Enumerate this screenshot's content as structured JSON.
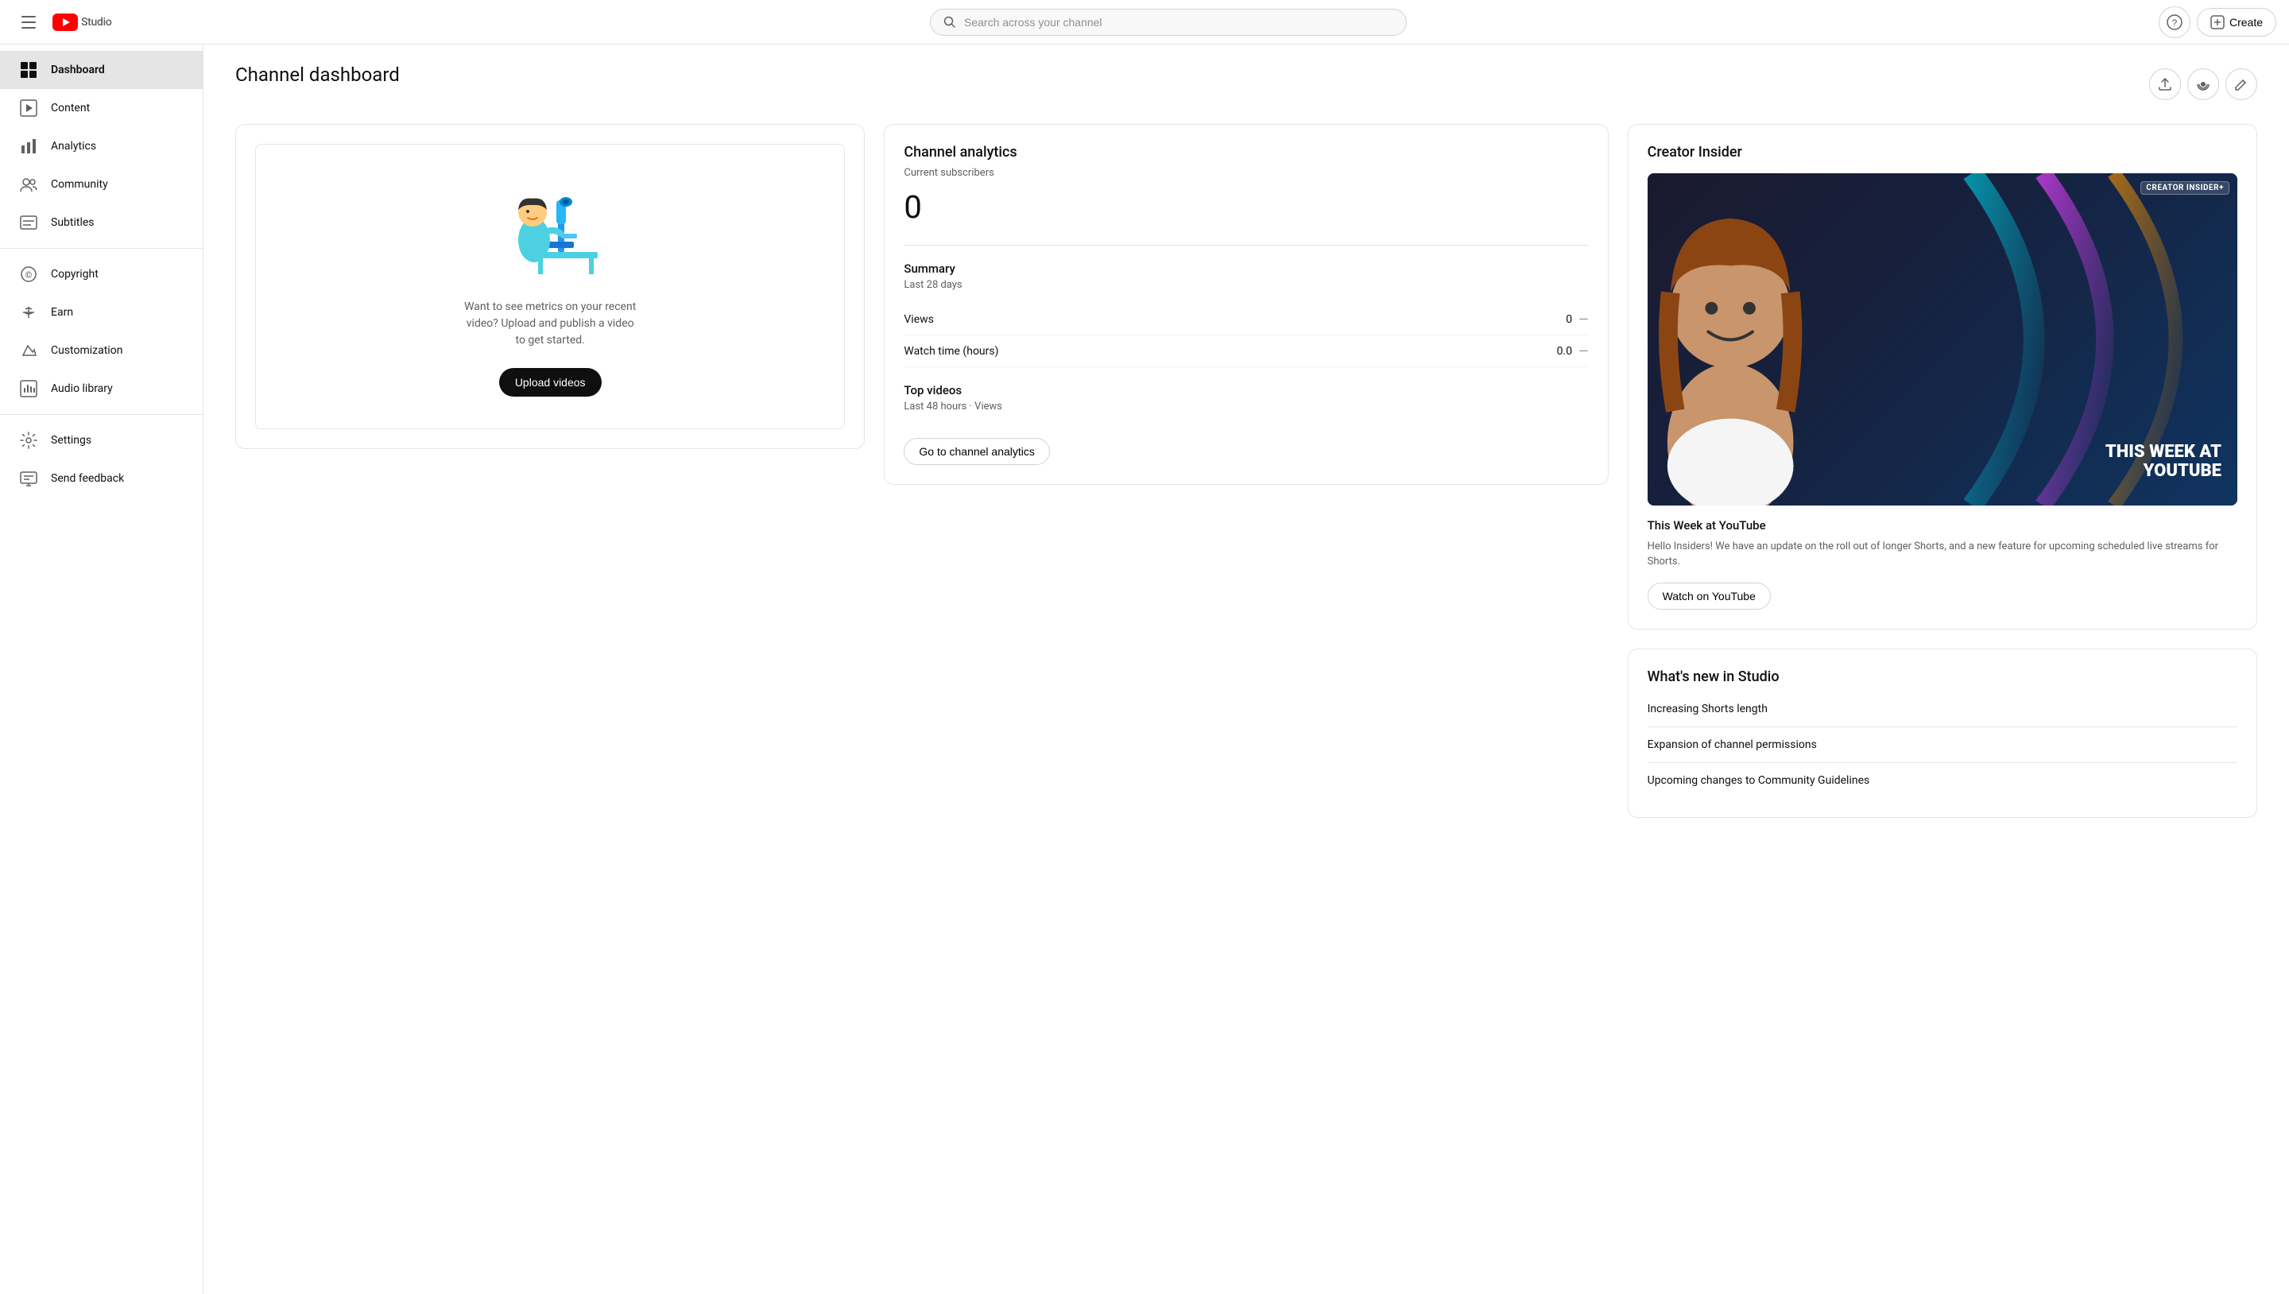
{
  "header": {
    "search_placeholder": "Search across your channel",
    "create_label": "Create",
    "help_title": "Help"
  },
  "sidebar": {
    "items": [
      {
        "id": "dashboard",
        "label": "Dashboard",
        "active": true
      },
      {
        "id": "content",
        "label": "Content",
        "active": false
      },
      {
        "id": "analytics",
        "label": "Analytics",
        "active": false
      },
      {
        "id": "community",
        "label": "Community",
        "active": false
      },
      {
        "id": "subtitles",
        "label": "Subtitles",
        "active": false
      },
      {
        "id": "copyright",
        "label": "Copyright",
        "active": false
      },
      {
        "id": "earn",
        "label": "Earn",
        "active": false
      },
      {
        "id": "customization",
        "label": "Customization",
        "active": false
      },
      {
        "id": "audio-library",
        "label": "Audio library",
        "active": false
      },
      {
        "id": "settings",
        "label": "Settings",
        "active": false
      },
      {
        "id": "send-feedback",
        "label": "Send feedback",
        "active": false
      }
    ]
  },
  "page": {
    "title": "Channel dashboard"
  },
  "upload_card": {
    "description": "Want to see metrics on your recent video? Upload and publish a video to get started.",
    "button_label": "Upload videos"
  },
  "analytics_card": {
    "title": "Channel analytics",
    "subscribers_label": "Current subscribers",
    "subscribers_count": "0",
    "summary_title": "Summary",
    "summary_period": "Last 28 days",
    "views_label": "Views",
    "views_value": "0",
    "watch_time_label": "Watch time (hours)",
    "watch_time_value": "0.0",
    "top_videos_title": "Top videos",
    "top_videos_period": "Last 48 hours · Views",
    "go_analytics_label": "Go to channel analytics"
  },
  "creator_insider": {
    "card_title": "Creator Insider",
    "badge_text": "CREATOR INSIDER+",
    "thumbnail_text": "THIS WEEK AT YOUTUBE",
    "video_title": "This Week at YouTube",
    "video_desc": "Hello Insiders! We have an update on the roll out of longer Shorts, and a new feature for upcoming scheduled live streams for Shorts.",
    "watch_label": "Watch on YouTube"
  },
  "whats_new": {
    "title": "What's new in Studio",
    "items": [
      {
        "label": "Increasing Shorts length"
      },
      {
        "label": "Expansion of channel permissions"
      },
      {
        "label": "Upcoming changes to Community Guidelines"
      }
    ]
  }
}
